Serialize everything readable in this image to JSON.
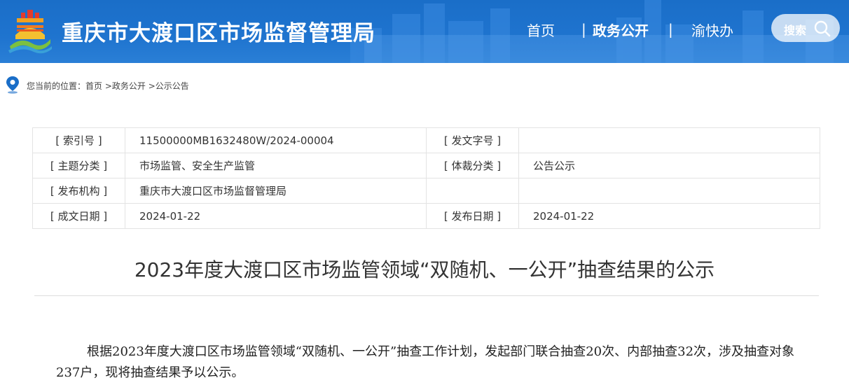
{
  "header": {
    "site_title": "重庆市大渡口区市场监督管理局",
    "nav": [
      {
        "label": "首页"
      },
      {
        "label": "政务公开"
      },
      {
        "label": "渝快办"
      }
    ],
    "separator": "|",
    "search_label": "搜索"
  },
  "breadcrumb": {
    "prefix": "您当前的位置：",
    "items": [
      "首页",
      ">政务公开",
      ">公示公告"
    ]
  },
  "meta_table": {
    "rows": [
      {
        "k1": "[ 索引号 ]",
        "v1": "11500000MB1632480W/2024-00004",
        "k2": "[ 发文字号 ]",
        "v2": ""
      },
      {
        "k1": "[ 主题分类 ]",
        "v1": "市场监管、安全生产监管",
        "k2": "[ 体裁分类 ]",
        "v2": "公告公示"
      },
      {
        "k1": "[ 发布机构 ]",
        "v1": "重庆市大渡口区市场监督管理局",
        "k2": "",
        "v2": ""
      },
      {
        "k1": "[ 成文日期 ]",
        "v1": "2024-01-22",
        "k2": "[ 发布日期 ]",
        "v2": "2024-01-22"
      }
    ]
  },
  "article": {
    "title": "2023年度大渡口区市场监管领域“双随机、一公开”抽查结果的公示",
    "paragraph": "根据2023年度大渡口区市场监管领域“双随机、一公开”抽查工作计划，发起部门联合抽查20次、内部抽查32次，涉及抽查对象237户，现将抽查结果予以公示。"
  },
  "colors": {
    "header_blue": "#1f74cf",
    "pin_blue": "#1a6ec8"
  }
}
